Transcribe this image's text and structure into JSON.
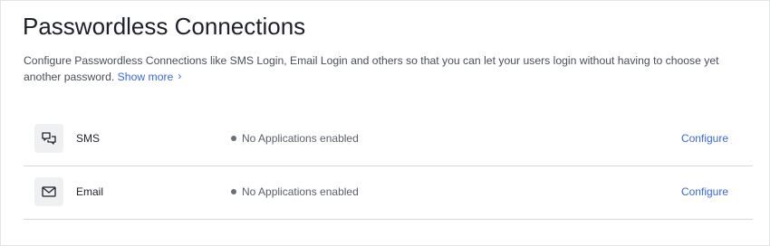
{
  "header": {
    "title": "Passwordless Connections",
    "description": "Configure Passwordless Connections like SMS Login, Email Login and others so that you can let your users login without having to choose yet another password.",
    "show_more": "Show more",
    "show_more_icon": "chevron-right-icon"
  },
  "connections": [
    {
      "name": "SMS",
      "icon": "chat-bubbles-icon",
      "status": "No Applications enabled",
      "action": "Configure"
    },
    {
      "name": "Email",
      "icon": "envelope-icon",
      "status": "No Applications enabled",
      "action": "Configure"
    }
  ],
  "colors": {
    "accent": "#3a66e8",
    "text": "#1e212a",
    "muted": "#5b606b",
    "divider": "#d6d8de",
    "icon_bg": "#eff0f2"
  }
}
